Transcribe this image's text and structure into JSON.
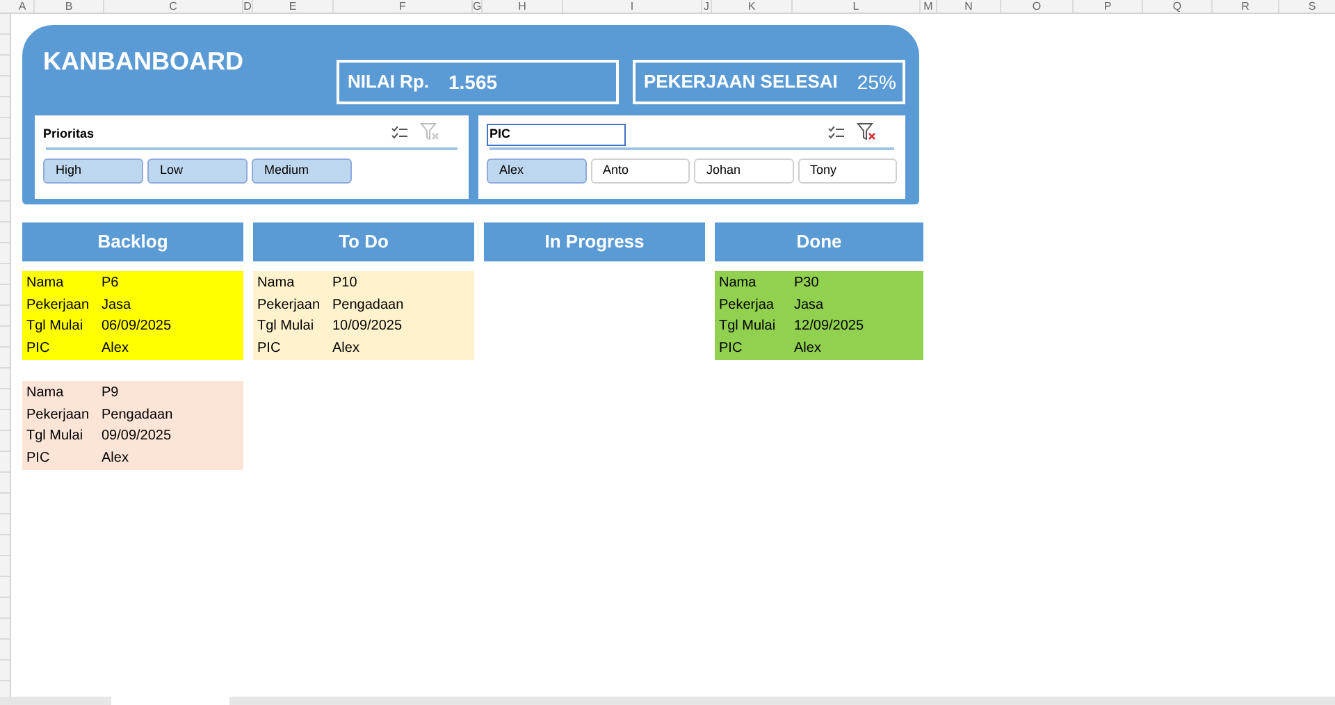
{
  "column_headers": [
    "A",
    "B",
    "C",
    "D",
    "E",
    "F",
    "G",
    "H",
    "I",
    "J",
    "K",
    "L",
    "M",
    "N",
    "O",
    "P",
    "Q",
    "R",
    "S"
  ],
  "board": {
    "title": "KANBANBOARD",
    "stats": [
      {
        "label": "NILAI Rp.",
        "value": "1.565"
      },
      {
        "label": "PEKERJAAN SELESAI",
        "value": "25%"
      }
    ],
    "slicers": [
      {
        "title": "Prioritas",
        "filtered": false,
        "items": [
          {
            "label": "High",
            "selected": true
          },
          {
            "label": "Low",
            "selected": true
          },
          {
            "label": "Medium",
            "selected": true
          }
        ]
      },
      {
        "title": "PIC",
        "filtered": true,
        "items": [
          {
            "label": "Alex",
            "selected": true
          },
          {
            "label": "Anto",
            "selected": false
          },
          {
            "label": "Johan",
            "selected": false
          },
          {
            "label": "Tony",
            "selected": false
          }
        ]
      }
    ]
  },
  "columns": [
    {
      "title": "Backlog",
      "cards": [
        {
          "color": "#ffff00",
          "fields": [
            {
              "label": "Nama",
              "value": "P6"
            },
            {
              "label": "Pekerjaan",
              "value": "Jasa"
            },
            {
              "label": "Tgl Mulai",
              "value": "06/09/2025"
            },
            {
              "label": "PIC",
              "value": "Alex"
            }
          ]
        },
        {
          "color": "#fce4d6",
          "fields": [
            {
              "label": "Nama",
              "value": "P9"
            },
            {
              "label": "Pekerjaan",
              "value": "Pengadaan"
            },
            {
              "label": "Tgl Mulai",
              "value": "09/09/2025"
            },
            {
              "label": "PIC",
              "value": "Alex"
            }
          ]
        }
      ]
    },
    {
      "title": "To Do",
      "cards": [
        {
          "color": "#fff2cc",
          "fields": [
            {
              "label": "Nama",
              "value": "P10"
            },
            {
              "label": "Pekerjaan",
              "value": "Pengadaan"
            },
            {
              "label": "Tgl Mulai",
              "value": "10/09/2025"
            },
            {
              "label": "PIC",
              "value": "Alex"
            }
          ]
        }
      ]
    },
    {
      "title": "In Progress"
    },
    {
      "title": "Done",
      "cards": [
        {
          "color": "#92d050",
          "fields": [
            {
              "label": "Nama",
              "value": "P30"
            },
            {
              "label": "Pekerjaa",
              "value": "Jasa"
            },
            {
              "label": "Tgl Mulai",
              "value": "12/09/2025"
            },
            {
              "label": "PIC",
              "value": "Alex"
            }
          ]
        }
      ]
    }
  ]
}
